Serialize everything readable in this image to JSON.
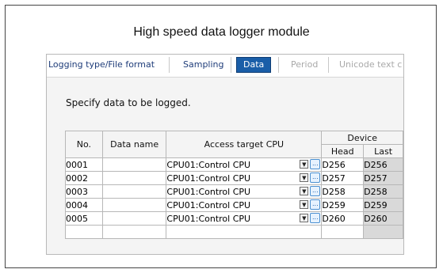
{
  "title": "High speed data logger module",
  "tabs": [
    {
      "label": "Logging type/File format",
      "state": "normal"
    },
    {
      "label": "Sampling",
      "state": "normal"
    },
    {
      "label": "Data",
      "state": "active"
    },
    {
      "label": "Period",
      "state": "disabled"
    },
    {
      "label": "Unicode text c",
      "state": "disabled"
    }
  ],
  "instruction": "Specify data to be logged.",
  "table": {
    "headers": {
      "no": "No.",
      "data_name": "Data name",
      "access_target_cpu": "Access target CPU",
      "device": "Device",
      "head": "Head",
      "last": "Last"
    },
    "rows": [
      {
        "no": "0001",
        "data_name": "",
        "cpu": "CPU01:Control CPU",
        "head": "D256",
        "last": "D256"
      },
      {
        "no": "0002",
        "data_name": "",
        "cpu": "CPU01:Control CPU",
        "head": "D257",
        "last": "D257"
      },
      {
        "no": "0003",
        "data_name": "",
        "cpu": "CPU01:Control CPU",
        "head": "D258",
        "last": "D258"
      },
      {
        "no": "0004",
        "data_name": "",
        "cpu": "CPU01:Control CPU",
        "head": "D259",
        "last": "D259"
      },
      {
        "no": "0005",
        "data_name": "",
        "cpu": "CPU01:Control CPU",
        "head": "D260",
        "last": "D260"
      }
    ],
    "dropdown_glyph": "▼",
    "browse_glyph": "..."
  },
  "colors": {
    "active_tab": "#1a5ea8",
    "last_cell_bg": "#d9d9d9",
    "border": "#b7b7b7"
  }
}
